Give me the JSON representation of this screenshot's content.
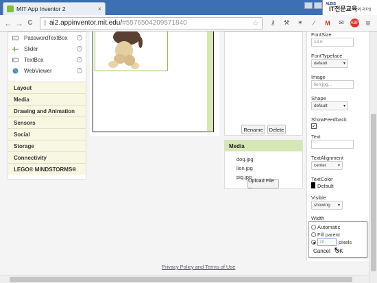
{
  "browser": {
    "tab_title": "MIT App Inventor 2",
    "tab_close": "×",
    "url_host": "ai2.appinventor.mit.edu/",
    "url_hash": "#5576504209571840",
    "logo_top": "ALBIS",
    "logo_main": "IT전문교육",
    "logo_suffix": "의 리더!",
    "back_icon": "←",
    "forward_icon": "→",
    "reload_icon": "C",
    "star_icon": "☆",
    "ext_gmail": "M",
    "ext_abp": "ABP",
    "menu_icon": "≡"
  },
  "palette": {
    "items": [
      {
        "label": "PasswordTextBox",
        "help": "?"
      },
      {
        "label": "Slider",
        "help": "?"
      },
      {
        "label": "TextBox",
        "help": "?"
      },
      {
        "label": "WebViewer",
        "help": "?"
      }
    ],
    "categories": [
      "Layout",
      "Media",
      "Drawing and Animation",
      "Sensors",
      "Social",
      "Storage",
      "Connectivity",
      "LEGO® MINDSTORMS®"
    ]
  },
  "components": {
    "rename_label": "Rename",
    "delete_label": "Delete"
  },
  "media": {
    "header": "Media",
    "files": [
      "dog.jpg",
      "lion.jpg",
      "pig.jpg"
    ],
    "upload_label": "Upload File ..."
  },
  "properties": {
    "font_size_label": "FontSize",
    "font_size_value": "14.0",
    "font_typeface_label": "FontTypeface",
    "font_typeface_value": "default",
    "image_label": "Image",
    "image_value": "lion.jpg...",
    "shape_label": "Shape",
    "shape_value": "default",
    "show_feedback_label": "ShowFeedback",
    "show_feedback_check": "✓",
    "text_label": "Text",
    "text_value": "",
    "text_alignment_label": "TextAlignment",
    "text_alignment_value": "center",
    "text_color_label": "TextColor",
    "text_color_value": "Default",
    "visible_label": "Visible",
    "visible_value": "showing",
    "width_label": "Width",
    "select_arrow": "▾"
  },
  "width_popup": {
    "automatic_label": "Automatic",
    "fill_parent_label": "Fill parent",
    "pixels_value": "70",
    "pixels_label": "pixels",
    "cancel_label": "Cancel",
    "ok_label": "OK",
    "selected": "pixels"
  },
  "footer": {
    "link": "Privacy Policy and Terms of Use"
  },
  "colors": {
    "accent_green": "#8bc34a",
    "media_header": "#d4e8b3",
    "category_bg": "#f8f8e2",
    "tab_bar": "#3d6fb5"
  }
}
